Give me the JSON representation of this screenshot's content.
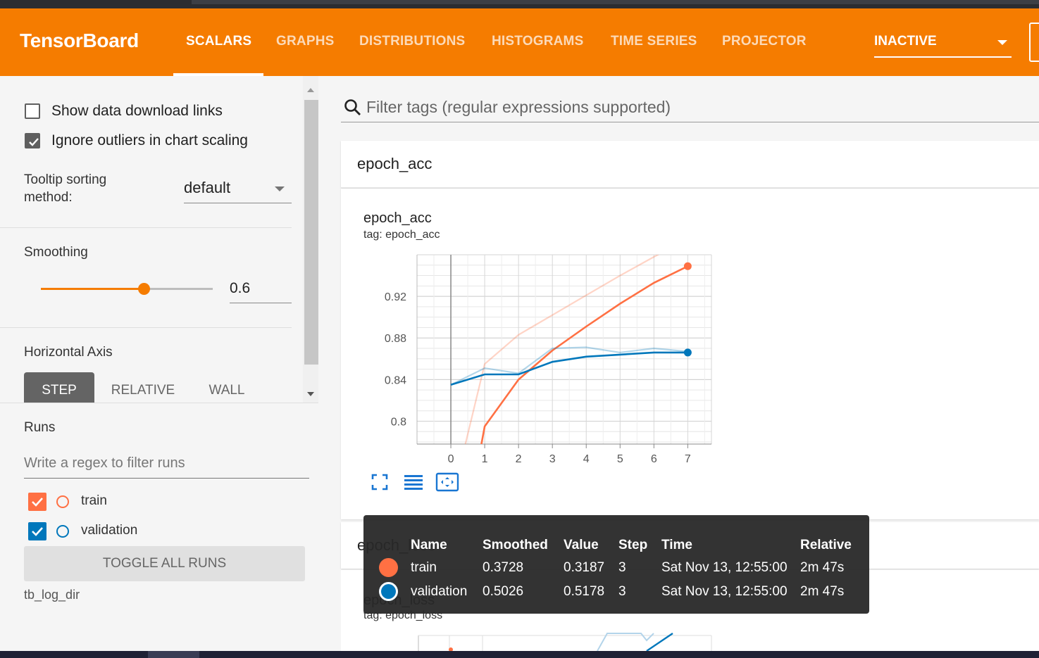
{
  "app": {
    "brand": "TensorBoard"
  },
  "nav": {
    "tabs": [
      {
        "label": "SCALARS",
        "active": true
      },
      {
        "label": "GRAPHS"
      },
      {
        "label": "DISTRIBUTIONS"
      },
      {
        "label": "HISTOGRAMS"
      },
      {
        "label": "TIME SERIES"
      },
      {
        "label": "PROJECTOR"
      }
    ],
    "plugin_select": "INACTIVE"
  },
  "sidebar": {
    "show_download_links": {
      "label": "Show data download links",
      "checked": false
    },
    "ignore_outliers": {
      "label": "Ignore outliers in chart scaling",
      "checked": true
    },
    "tooltip_sorting": {
      "label_line1": "Tooltip sorting",
      "label_line2": "method:",
      "value": "default"
    },
    "smoothing": {
      "label": "Smoothing",
      "value": "0.6",
      "fraction": 0.6
    },
    "horizontal_axis": {
      "label": "Horizontal Axis",
      "options": [
        "STEP",
        "RELATIVE",
        "WALL"
      ],
      "selected": "STEP"
    },
    "runs": {
      "label": "Runs",
      "filter_placeholder": "Write a regex to filter runs",
      "items": [
        {
          "name": "train",
          "checked": true,
          "color": "#ff7043"
        },
        {
          "name": "validation",
          "checked": true,
          "color": "#0077bb"
        }
      ],
      "toggle_all": "TOGGLE ALL RUNS",
      "log_dir": "tb_log_dir"
    }
  },
  "main": {
    "search_placeholder": "Filter tags (regular expressions supported)",
    "cards": [
      {
        "header": "epoch_acc",
        "title": "epoch_acc",
        "subtitle": "tag: epoch_acc"
      },
      {
        "header": "epoch_loss",
        "title": "epoch_loss",
        "subtitle": "tag: epoch_loss"
      }
    ]
  },
  "chart_data": {
    "type": "line",
    "title": "epoch_acc",
    "subtitle": "tag: epoch_acc",
    "x": [
      0,
      1,
      2,
      3,
      4,
      5,
      6,
      7
    ],
    "xlim": [
      -1,
      7.7
    ],
    "ylim": [
      0.778,
      0.96
    ],
    "yticks": [
      "0.8",
      "0.84",
      "0.88",
      "0.92"
    ],
    "xticks": [
      "0",
      "1",
      "2",
      "3",
      "4",
      "5",
      "6",
      "7"
    ],
    "grid": true,
    "series": [
      {
        "name": "train",
        "color": "#ff7043",
        "values": [
          0.72,
          0.855,
          0.883,
          0.902,
          0.921,
          0.94,
          0.958,
          0.975
        ]
      },
      {
        "name": "train",
        "color": "#ff7043",
        "values": [
          0.62,
          0.795,
          0.84,
          0.868,
          0.891,
          0.913,
          0.933,
          0.949
        ]
      },
      {
        "name": "validation",
        "color": "#0077bb",
        "values": [
          0.835,
          0.851,
          0.846,
          0.87,
          0.871,
          0.866,
          0.87,
          0.867
        ]
      },
      {
        "name": "validation",
        "color": "#0077bb",
        "values": [
          0.835,
          0.845,
          0.845,
          0.857,
          0.862,
          0.864,
          0.866,
          0.866
        ]
      }
    ]
  },
  "tooltip": {
    "headers": {
      "name": "Name",
      "smoothed": "Smoothed",
      "value": "Value",
      "step": "Step",
      "time": "Time",
      "relative": "Relative"
    },
    "rows": [
      {
        "color": "#ff7043",
        "name": "train",
        "smoothed": "0.3728",
        "value": "0.3187",
        "step": "3",
        "time": "Sat Nov 13, 12:55:00",
        "relative": "2m 47s"
      },
      {
        "color": "#0077bb",
        "name": "validation",
        "smoothed": "0.5026",
        "value": "0.5178",
        "step": "3",
        "time": "Sat Nov 13, 12:55:00",
        "relative": "2m 47s"
      }
    ]
  }
}
